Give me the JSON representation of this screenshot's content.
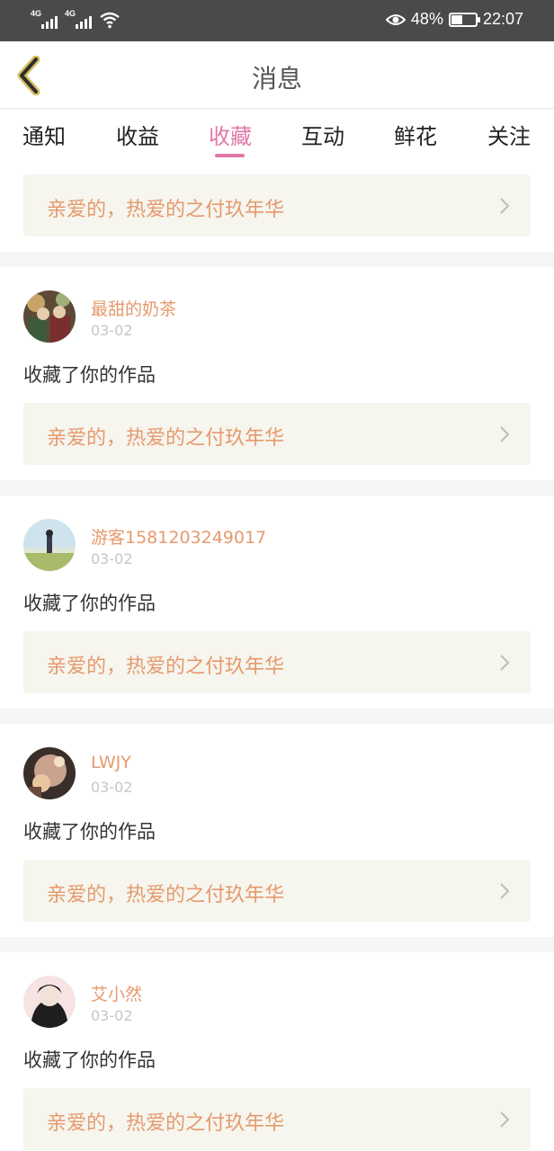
{
  "status_bar": {
    "signal1": "4G",
    "signal2": "4G",
    "battery_percent": "48%",
    "battery_level": 0.48,
    "time": "22:07"
  },
  "header": {
    "title": "消息"
  },
  "tabs": [
    {
      "label": "通知",
      "active": false
    },
    {
      "label": "收益",
      "active": false
    },
    {
      "label": "收藏",
      "active": true
    },
    {
      "label": "互动",
      "active": false
    },
    {
      "label": "鲜花",
      "active": false
    },
    {
      "label": "关注",
      "active": false
    }
  ],
  "colors": {
    "accent": "#e078a8",
    "username": "#e59a6e",
    "work_bg": "#f6f5ee"
  },
  "top_item": {
    "work_title": "亲爱的，热爱的之付玖年华"
  },
  "items": [
    {
      "username": "最甜的奶茶",
      "date": "03-02",
      "action": "收藏了你的作品",
      "work_title": "亲爱的，热爱的之付玖年华"
    },
    {
      "username": "游客1581203249017",
      "date": "03-02",
      "action": "收藏了你的作品",
      "work_title": "亲爱的，热爱的之付玖年华"
    },
    {
      "username": "LWJY",
      "date": "03-02",
      "action": "收藏了你的作品",
      "work_title": "亲爱的，热爱的之付玖年华"
    },
    {
      "username": "艾小然",
      "date": "03-02",
      "action": "收藏了你的作品",
      "work_title": "亲爱的，热爱的之付玖年华"
    }
  ]
}
